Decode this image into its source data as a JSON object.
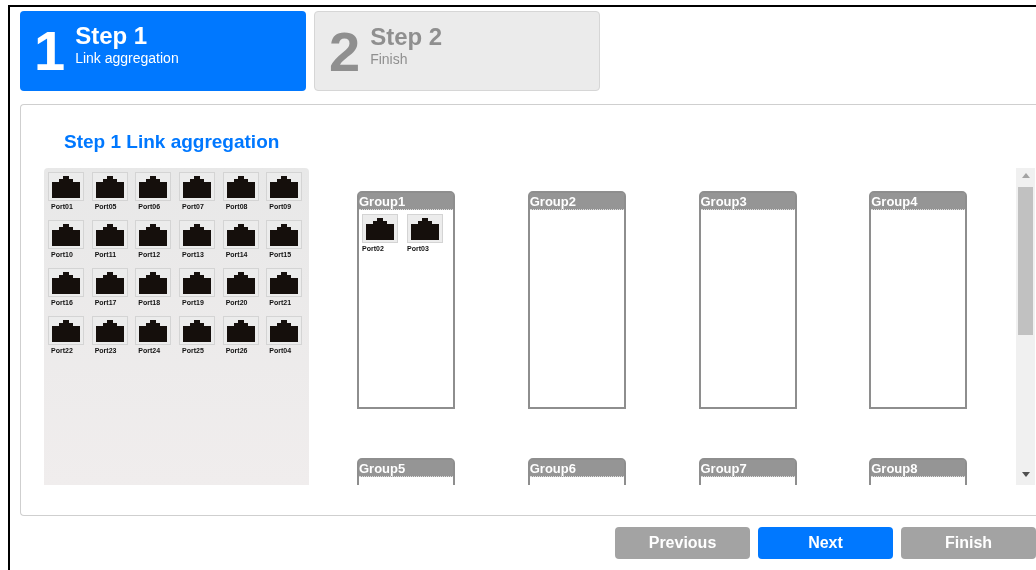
{
  "steps": [
    {
      "number": "1",
      "title": "Step 1",
      "subtitle": "Link aggregation",
      "selected": true
    },
    {
      "number": "2",
      "title": "Step 2",
      "subtitle": "Finish",
      "selected": false
    }
  ],
  "panel": {
    "title": "Step 1 Link aggregation"
  },
  "available_ports": [
    "Port01",
    "Port05",
    "Port06",
    "Port07",
    "Port08",
    "Port09",
    "Port10",
    "Port11",
    "Port12",
    "Port13",
    "Port14",
    "Port15",
    "Port16",
    "Port17",
    "Port18",
    "Port19",
    "Port20",
    "Port21",
    "Port22",
    "Port23",
    "Port24",
    "Port25",
    "Port26",
    "Port04"
  ],
  "groups": [
    {
      "name": "Group1",
      "ports": [
        "Port02",
        "Port03"
      ]
    },
    {
      "name": "Group2"
    },
    {
      "name": "Group3"
    },
    {
      "name": "Group4"
    },
    {
      "name": "Group5"
    },
    {
      "name": "Group6"
    },
    {
      "name": "Group7"
    },
    {
      "name": "Group8"
    }
  ],
  "buttons": [
    {
      "label": "Previous",
      "disabled": true
    },
    {
      "label": "Next",
      "disabled": false
    },
    {
      "label": "Finish",
      "disabled": true
    }
  ]
}
